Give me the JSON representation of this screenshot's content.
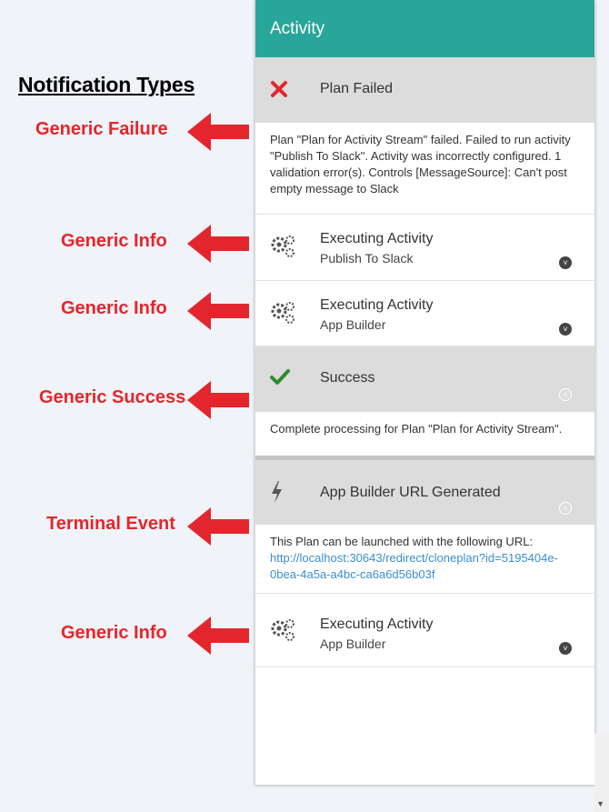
{
  "annotations": {
    "title": "Notification Types",
    "labels": [
      "Generic Failure",
      "Generic Info",
      "Generic Info",
      "Generic Success",
      "Terminal Event",
      "Generic Info"
    ]
  },
  "panel": {
    "title": "Activity",
    "items": [
      {
        "type": "failure",
        "title": "Plan Failed",
        "body": "Plan \"Plan for Activity Stream\" failed. Failed to run activity \"Publish To Slack\". Activity was incorrectly configured. 1 validation error(s). Controls [MessageSource]: Can't post empty message to Slack"
      },
      {
        "type": "info",
        "title": "Executing Activity",
        "subtitle": "Publish To Slack"
      },
      {
        "type": "info",
        "title": "Executing Activity",
        "subtitle": "App Builder"
      },
      {
        "type": "success",
        "title": "Success",
        "body": "Complete processing for Plan \"Plan for Activity Stream\"."
      },
      {
        "type": "terminal",
        "title": "App Builder URL Generated",
        "body": "This Plan can be launched with the following URL:",
        "link": "http://localhost:30643/redirect/cloneplan?id=5195404e-0bea-4a5a-a4bc-ca6a6d56b03f"
      },
      {
        "type": "info",
        "title": "Executing Activity",
        "subtitle": "App Builder"
      }
    ]
  },
  "colors": {
    "header": "#27a699",
    "annotation": "#e3262d",
    "failure": "#e3262d",
    "success": "#2e8b2e",
    "link": "#3b8ed1"
  },
  "icons": {
    "failure": "close-icon",
    "info": "gears-icon",
    "success": "check-icon",
    "terminal": "lightning-icon",
    "expand": "chevron-down-icon",
    "collapse": "chevron-up-icon"
  }
}
